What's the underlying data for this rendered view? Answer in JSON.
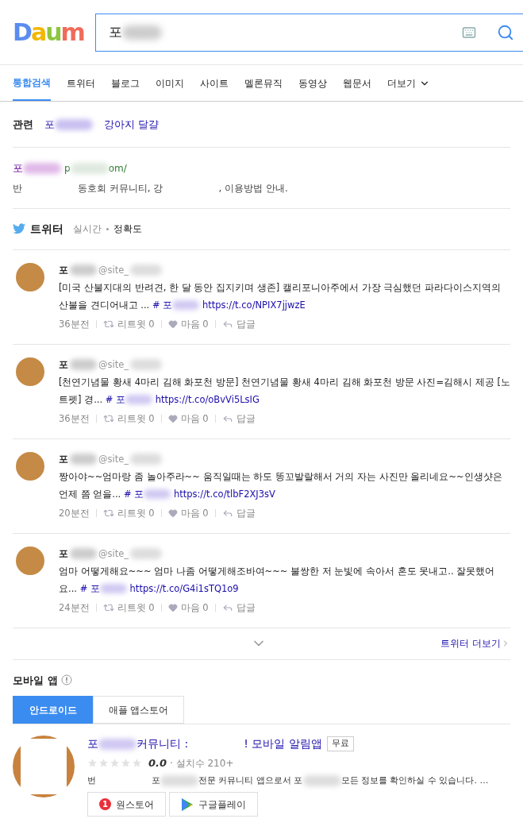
{
  "logo": "Daum",
  "search": {
    "value": "포"
  },
  "tabs": [
    {
      "label": "통합검색",
      "selected": true
    },
    {
      "label": "트위터",
      "selected": false
    },
    {
      "label": "블로그",
      "selected": false
    },
    {
      "label": "이미지",
      "selected": false
    },
    {
      "label": "사이트",
      "selected": false
    },
    {
      "label": "멜론뮤직",
      "selected": false
    },
    {
      "label": "동영상",
      "selected": false
    },
    {
      "label": "웹문서",
      "selected": false
    },
    {
      "label": "더보기",
      "selected": false
    }
  ],
  "related": {
    "label": "관련",
    "links": [
      [
        {
          "kind": "text",
          "text": "포"
        },
        {
          "kind": "blur"
        }
      ],
      [
        {
          "kind": "text",
          "text": "강아지 달걀"
        }
      ]
    ]
  },
  "site": {
    "title": [
      {
        "kind": "text",
        "text": "포"
      },
      {
        "kind": "blur"
      }
    ],
    "url": [
      {
        "kind": "text",
        "text": "p"
      },
      {
        "kind": "blur"
      },
      {
        "kind": "text",
        "text": "om/"
      }
    ],
    "description": [
      {
        "kind": "text",
        "text": "반"
      },
      {
        "kind": "gap"
      },
      {
        "kind": "text",
        "text": "동호회 커뮤니티, 강"
      },
      {
        "kind": "gap"
      },
      {
        "kind": "text",
        "text": ", 이용방법 안내."
      }
    ]
  },
  "twitter": {
    "title": "트위터",
    "sort": [
      {
        "label": "실시간",
        "selected": false
      },
      {
        "label": "정확도",
        "selected": true
      }
    ],
    "tweets": [
      {
        "name": "포",
        "handle": "@site_",
        "text": "[미국 산불지대의 반려견, 한 달 동안 집지키며 생존]      캘리포니아주에서 가장 극심했던 파라다이스지역의 산불을 견디어내고 ...",
        "hashtag": "# 포",
        "link": "https://t.co/NPIX7jjwzE",
        "time": "36분전",
        "retweet": "리트윗 0",
        "like": "마음 0",
        "reply": "답글"
      },
      {
        "name": "포",
        "handle": "@site_",
        "text": "[천연기념물 황새 4마리 김해 화포천 방문] 천연기념물 황새 4마리 김해 화포천 방문 사진=김해시 제공  [노트펫] 경...",
        "hashtag": "# 포",
        "link": "https://t.co/oBvVi5LsIG",
        "time": "36분전",
        "retweet": "리트윗 0",
        "like": "마음 0",
        "reply": "답글"
      },
      {
        "name": "포",
        "handle": "@site_",
        "text": "짱아야~~엄마랑 좀 놀아주라~~ 움직일때는 하도 똥꼬발랄해서 거의 자는 사진만 올리네요~~인생샷은 언제 쯤 얻을...",
        "hashtag": "# 포",
        "link": "https://t.co/tlbF2XJ3sV",
        "time": "20분전",
        "retweet": "리트윗 0",
        "like": "마음 0",
        "reply": "답글"
      },
      {
        "name": "포",
        "handle": "@site_",
        "text": "엄마 어떻게해요~~~ 엄마 나좀 어떻게해조바여~~~ 불쌍한 저 눈빛에 속아서 혼도 못내고.. 잘못했어요...",
        "hashtag": "# 포",
        "link": "https://t.co/G4i1sTQ1o9",
        "time": "24분전",
        "retweet": "리트윗 0",
        "like": "마음 0",
        "reply": "답글"
      }
    ],
    "more": "트위터 더보기"
  },
  "apps": {
    "title": "모바일 앱",
    "tabs": [
      {
        "label": "안드로이드",
        "selected": true
      },
      {
        "label": "애플 앱스토어",
        "selected": false
      }
    ],
    "items": [
      {
        "title": [
          {
            "kind": "text",
            "text": "포"
          },
          {
            "kind": "blur"
          },
          {
            "kind": "text",
            "text": "커뮤니티 :"
          },
          {
            "kind": "gap"
          },
          {
            "kind": "text",
            "text": "! 모바일 알림앱"
          }
        ],
        "badge": "무료",
        "stars": 0,
        "rating": "0.0",
        "installs": "· 설치수 210+",
        "description": [
          {
            "kind": "text",
            "text": "번"
          },
          {
            "kind": "gap"
          },
          {
            "kind": "text",
            "text": "포"
          },
          {
            "kind": "blur"
          },
          {
            "kind": "text",
            "text": "전문 커뮤니티 앱으로서 포"
          },
          {
            "kind": "blur"
          },
          {
            "kind": "text",
            "text": "모든 정보를 확인하실 수 있습니다. …"
          }
        ],
        "stores": [
          {
            "kind": "onestore",
            "mark": "1",
            "label": "원스토어"
          },
          {
            "kind": "googleplay",
            "label": "구글플레이"
          }
        ]
      }
    ]
  }
}
